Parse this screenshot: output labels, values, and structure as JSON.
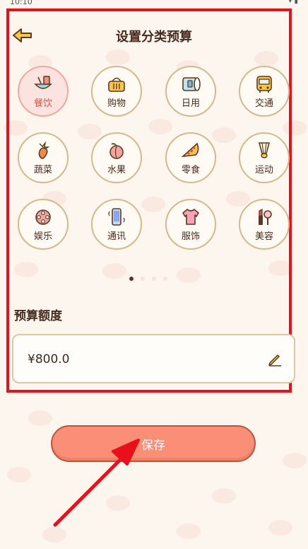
{
  "status_bar": {
    "time": "10:10"
  },
  "header": {
    "title": "设置分类预算"
  },
  "categories": [
    {
      "label": "餐饮",
      "icon": "dining-icon",
      "selected": true
    },
    {
      "label": "购物",
      "icon": "shopping-basket-icon"
    },
    {
      "label": "日用",
      "icon": "tissue-roll-icon"
    },
    {
      "label": "交通",
      "icon": "bus-icon"
    },
    {
      "label": "蔬菜",
      "icon": "carrot-icon"
    },
    {
      "label": "水果",
      "icon": "peach-icon"
    },
    {
      "label": "零食",
      "icon": "pizza-icon"
    },
    {
      "label": "运动",
      "icon": "shuttlecock-icon"
    },
    {
      "label": "娱乐",
      "icon": "film-reel-icon"
    },
    {
      "label": "通讯",
      "icon": "phone-icon"
    },
    {
      "label": "服饰",
      "icon": "shirt-icon"
    },
    {
      "label": "美容",
      "icon": "cosmetics-icon"
    }
  ],
  "pagination": {
    "pages": 4,
    "active": 1
  },
  "budget": {
    "label": "预算额度",
    "amount": "¥800.0"
  },
  "actions": {
    "save_label": "保存"
  },
  "colors": {
    "highlight_frame": "#e8101b",
    "save_button": "#fb8e76",
    "annotation_arrow": "#e8101b",
    "selected_bg": "#fde3df",
    "ring": "#d6b88d"
  }
}
